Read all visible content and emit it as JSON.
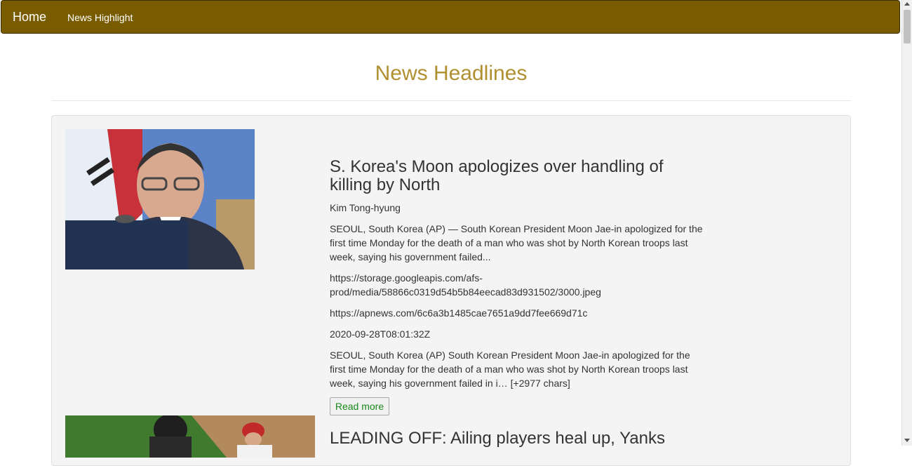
{
  "navbar": {
    "brand": "Home",
    "links": [
      "News Highlight"
    ],
    "background": "#7a5c00"
  },
  "page": {
    "title": "News Headlines",
    "title_color": "#b09030"
  },
  "articles": [
    {
      "title_line1": "S. Korea's Moon apologizes over handling of",
      "title_line2": "killing by North",
      "author": "Kim Tong-hyung",
      "description_lines": [
        "SEOUL, South Korea (AP) — South Korean President Moon Jae-in apologized for the",
        "first time Monday for the death of a man who was shot by North Korean troops last",
        "week, saying his government failed..."
      ],
      "image_url_lines": [
        "https://storage.googleapis.com/afs-",
        "prod/media/58866c0319d54b5b84eecad83d931502/3000.jpeg"
      ],
      "url": "https://apnews.com/6c6a3b1485cae7651a9dd7fee669d71c",
      "published_at": "2020-09-28T08:01:32Z",
      "content_lines": [
        "SEOUL, South Korea (AP) South Korean President Moon Jae-in apologized for the",
        "first time Monday for the death of a man who was shot by North Korean troops last",
        "week, saying his government failed in i… [+2977 chars]"
      ],
      "read_more_label": "Read more"
    },
    {
      "title_line1": "LEADING OFF: Ailing players heal up, Yanks"
    }
  ]
}
